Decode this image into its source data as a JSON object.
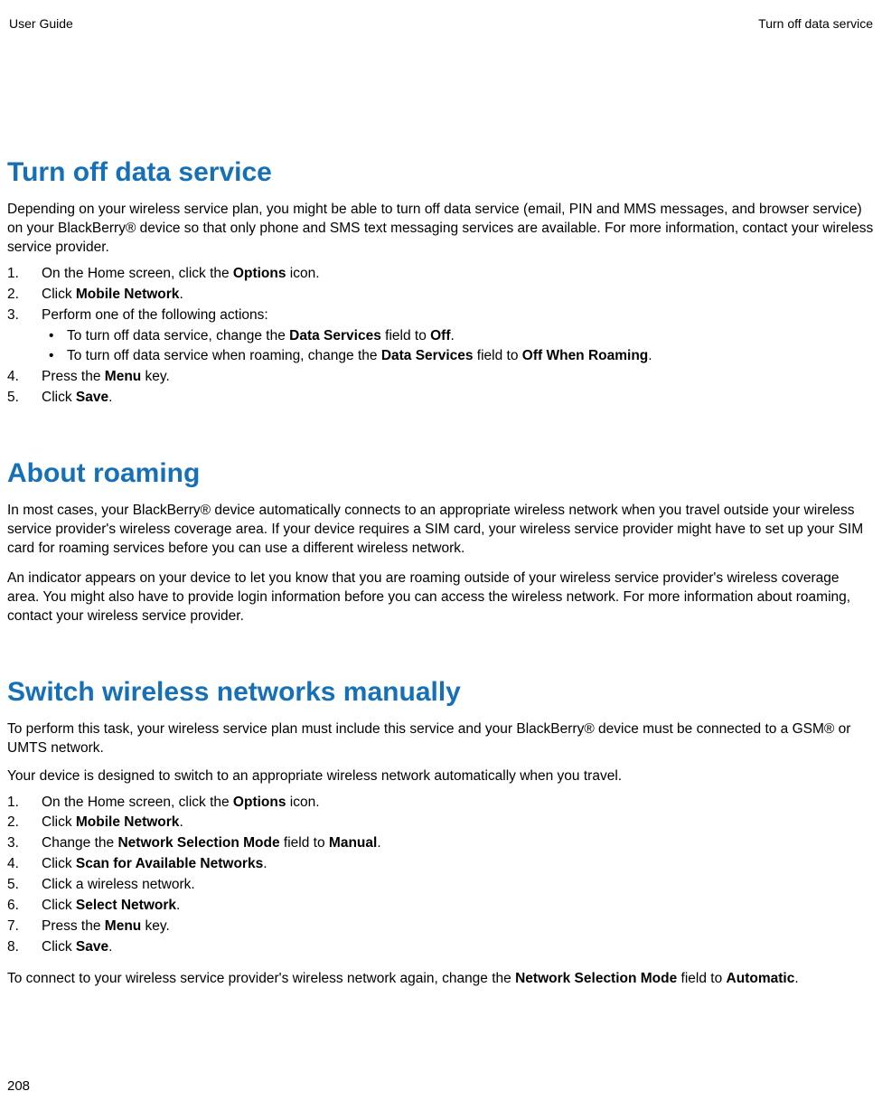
{
  "header": {
    "left": "User Guide",
    "right": "Turn off data service"
  },
  "page_number": "208",
  "s1": {
    "title": "Turn off data service",
    "intro": "Depending on your wireless service plan, you might be able to turn off data service (email, PIN and MMS messages, and browser service) on your BlackBerry® device so that only phone and SMS text messaging services are available. For more information, contact your wireless service provider.",
    "li1a": "On the Home screen, click the ",
    "li1b": "Options",
    "li1c": " icon.",
    "li2a": "Click ",
    "li2b": "Mobile Network",
    "li2c": ".",
    "li3": "Perform one of the following actions:",
    "li3_b1a": "To turn off data service, change the ",
    "li3_b1b": "Data Services",
    "li3_b1c": " field to ",
    "li3_b1d": "Off",
    "li3_b1e": ".",
    "li3_b2a": "To turn off data service when roaming, change the ",
    "li3_b2b": "Data Services",
    "li3_b2c": " field to ",
    "li3_b2d": "Off When Roaming",
    "li3_b2e": ".",
    "li4a": "Press the ",
    "li4b": "Menu",
    "li4c": " key.",
    "li5a": "Click ",
    "li5b": "Save",
    "li5c": "."
  },
  "s2": {
    "title": "About roaming",
    "p1": "In most cases, your BlackBerry® device automatically connects to an appropriate wireless network when you travel outside your wireless service provider's wireless coverage area. If your device requires a SIM card, your wireless service provider might have to set up your SIM card for roaming services before you can use a different wireless network.",
    "p2": "An indicator appears on your device to let you know that you are roaming outside of your wireless service provider's wireless coverage area. You might also have to provide login information before you can access the wireless network. For more information about roaming, contact your wireless service provider."
  },
  "s3": {
    "title": "Switch wireless networks manually",
    "p1": "To perform this task, your wireless service plan must include this service and your BlackBerry® device must be connected to a GSM® or UMTS network.",
    "p2": "Your device is designed to switch to an appropriate wireless network automatically when you travel.",
    "li1a": "On the Home screen, click the ",
    "li1b": "Options",
    "li1c": " icon.",
    "li2a": "Click ",
    "li2b": "Mobile Network",
    "li2c": ".",
    "li3a": "Change the ",
    "li3b": "Network Selection Mode",
    "li3c": " field to ",
    "li3d": "Manual",
    "li3e": ".",
    "li4a": "Click ",
    "li4b": "Scan for Available Networks",
    "li4c": ".",
    "li5": "Click a wireless network.",
    "li6a": "Click ",
    "li6b": "Select Network",
    "li6c": ".",
    "li7a": "Press the ",
    "li7b": "Menu",
    "li7c": " key.",
    "li8a": "Click ",
    "li8b": "Save",
    "li8c": ".",
    "outro_a": "To connect to your wireless service provider's wireless network again, change the ",
    "outro_b": "Network Selection Mode",
    "outro_c": " field to ",
    "outro_d": "Automatic",
    "outro_e": "."
  }
}
